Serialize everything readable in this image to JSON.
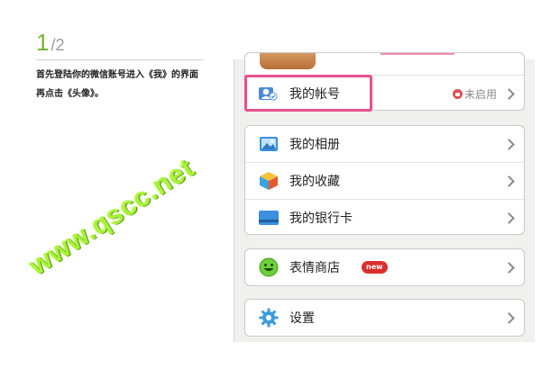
{
  "step": {
    "current": "1",
    "total": "/2",
    "instruction_line1": "首先登陆你的微信账号进入《我》的界面",
    "instruction_line2": "再点击《头像》。"
  },
  "watermark": "www.qscc.net",
  "menu": {
    "account": {
      "label": "我的帐号",
      "status": "未启用",
      "icon": "account-icon"
    },
    "album": {
      "label": "我的相册",
      "icon": "photo-album-icon"
    },
    "favorites": {
      "label": "我的收藏",
      "icon": "favorites-cube-icon"
    },
    "bank_card": {
      "label": "我的银行卡",
      "icon": "bank-card-icon"
    },
    "sticker_store": {
      "label": "表情商店",
      "badge": "new",
      "icon": "smiley-icon"
    },
    "settings": {
      "label": "设置",
      "icon": "gear-icon"
    }
  },
  "colors": {
    "step_accent": "#7bb13b",
    "highlight_border": "#e84f8c",
    "watermark": "#a8f23a",
    "new_badge": "#d9302d"
  }
}
